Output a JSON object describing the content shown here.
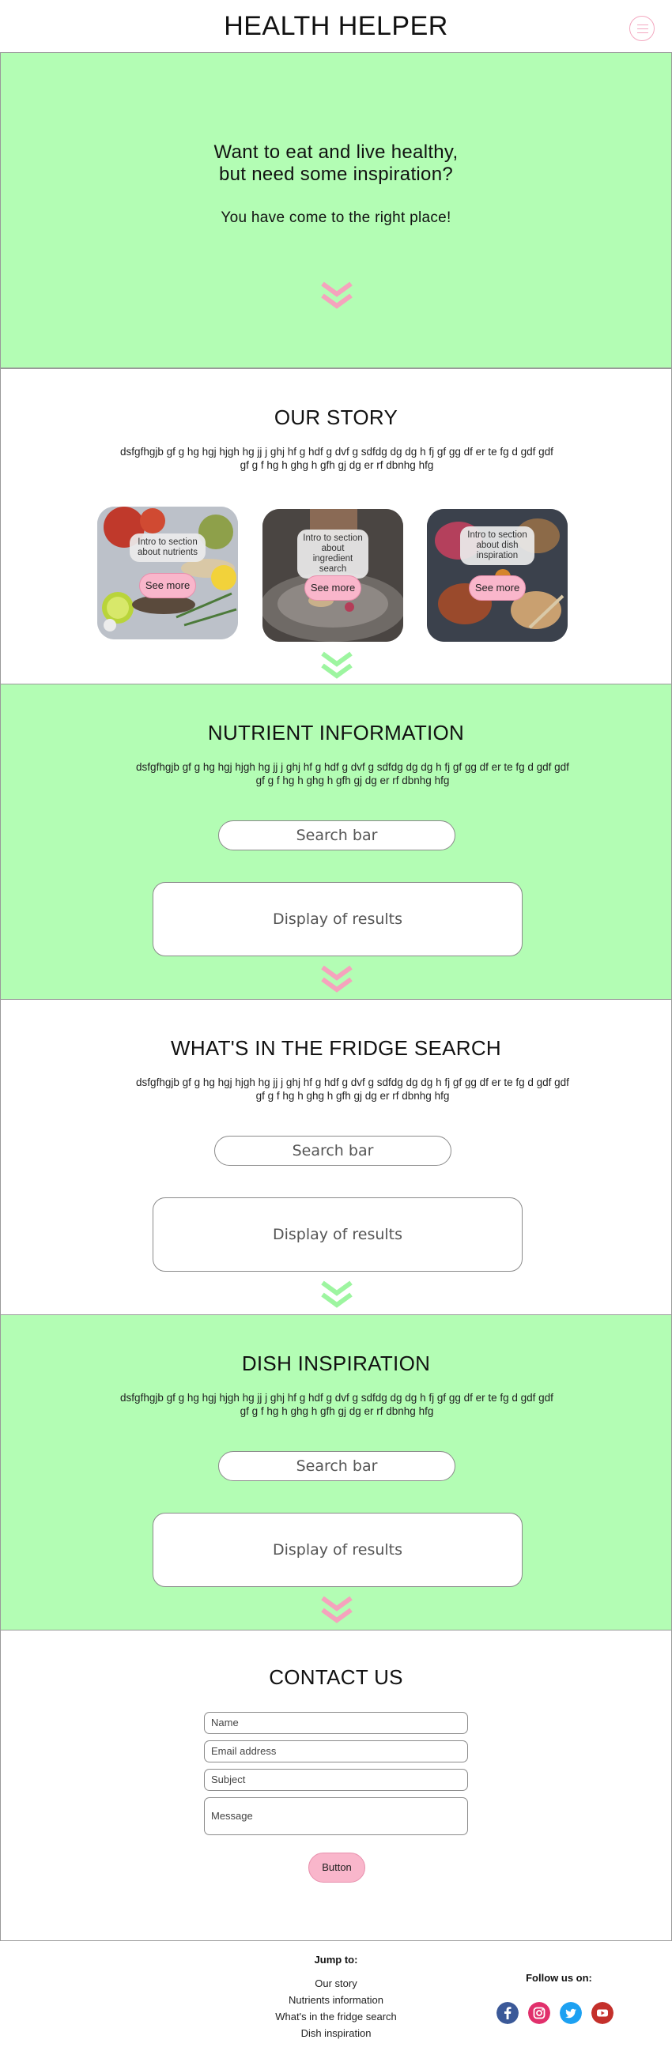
{
  "header": {
    "title": "HEALTH HELPER",
    "menu_icon": "hamburger-menu-icon"
  },
  "hero": {
    "headline_line1": "Want to eat and live healthy,",
    "headline_line2": "but need some inspiration?",
    "subtitle": "You have come to the right place!",
    "scroll_icon": "double-chevron-down-icon"
  },
  "story": {
    "title": "OUR STORY",
    "text": "dsfgfhgjb gf g hg hgj hjgh hg jj j ghj hf g hdf g dvf g sdfdg dg dg h fj gf gg df er te  fg d gdf gdf gf g f hg h ghg h gfh gj  dg er rf dbnhg hfg",
    "cards": [
      {
        "caption": "Intro to section about nutrients",
        "button": "See more"
      },
      {
        "caption": "Intro to section about ingredient search",
        "button": "See more"
      },
      {
        "caption": "Intro to section about dish inspiration",
        "button": "See more"
      }
    ]
  },
  "nutrients": {
    "title": "NUTRIENT INFORMATION",
    "text": "dsfgfhgjb gf g hg hgj hjgh hg jj j ghj hf g hdf g dvf g sdfdg dg dg h fj gf gg df er te  fg d gdf gdf gf g f hg h ghg h gfh gj  dg er rf dbnhg hfg",
    "search_label": "Search bar",
    "results_label": "Display of results"
  },
  "fridge": {
    "title": "WHAT'S IN THE FRIDGE SEARCH",
    "text": "dsfgfhgjb gf g hg hgj hjgh hg jj j ghj hf g hdf g dvf g sdfdg dg dg h fj gf gg df er te  fg d gdf gdf gf g f hg h ghg h gfh gj  dg er rf dbnhg hfg",
    "search_label": "Search bar",
    "results_label": "Display of results"
  },
  "dishes": {
    "title": "DISH INSPIRATION",
    "text": "dsfgfhgjb gf g hg hgj hjgh hg jj j ghj hf g hdf g dvf g sdfdg dg dg h fj gf gg df er te  fg d gdf gdf gf g f hg h ghg h gfh gj  dg er rf dbnhg hfg",
    "search_label": "Search bar",
    "results_label": "Display of results"
  },
  "contact": {
    "title": "CONTACT US",
    "name_placeholder": "Name",
    "email_placeholder": "Email address",
    "subject_placeholder": "Subject",
    "message_placeholder": "Message",
    "button": "Button"
  },
  "footer": {
    "jump_title": "Jump to:",
    "links": [
      "Our story",
      "Nutrients information",
      "What's in the fridge search",
      "Dish inspiration"
    ],
    "follow_title": "Follow us on:",
    "social": [
      "facebook-icon",
      "instagram-icon",
      "twitter-icon",
      "youtube-icon"
    ]
  },
  "colors": {
    "green": "#b3fdb4",
    "pink": "#f9b6cb",
    "pink_chevron": "#f5a3bd",
    "green_chevron": "#9df5a0",
    "facebook": "#3b5998",
    "instagram": "#e1306c",
    "twitter": "#1da1f2",
    "youtube": "#c4302b"
  }
}
